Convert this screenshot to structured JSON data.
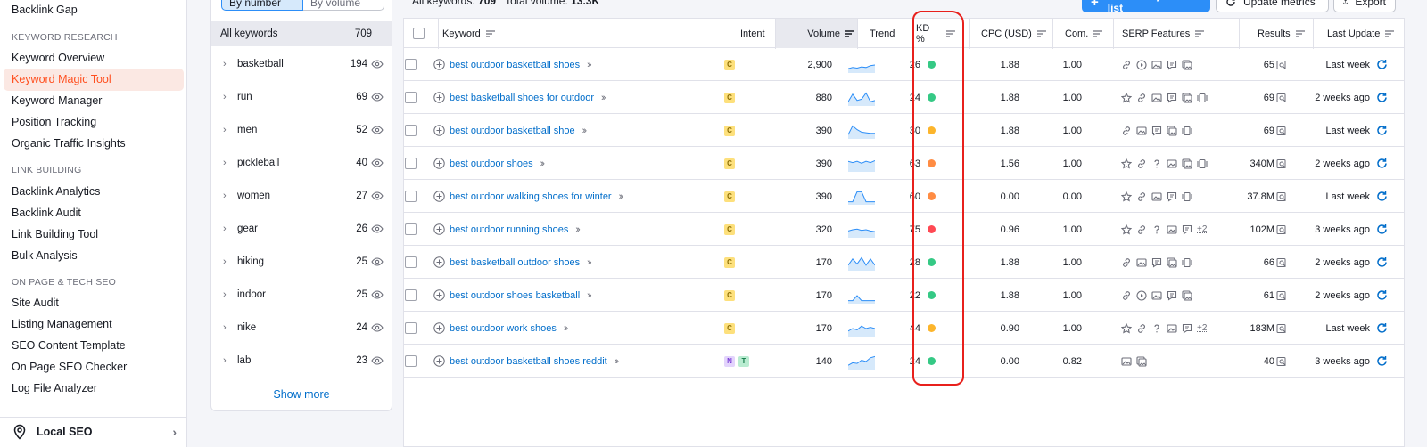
{
  "nav": {
    "top_item": "Backlink Gap",
    "sections": [
      {
        "title": "KEYWORD RESEARCH",
        "items": [
          "Keyword Overview",
          "Keyword Magic Tool",
          "Keyword Manager",
          "Position Tracking",
          "Organic Traffic Insights"
        ]
      },
      {
        "title": "LINK BUILDING",
        "items": [
          "Backlink Analytics",
          "Backlink Audit",
          "Link Building Tool",
          "Bulk Analysis"
        ]
      },
      {
        "title": "ON PAGE & TECH SEO",
        "items": [
          "Site Audit",
          "Listing Management",
          "SEO Content Template",
          "On Page SEO Checker",
          "Log File Analyzer"
        ]
      }
    ],
    "active_item": "Keyword Magic Tool",
    "footer": "Local SEO",
    "accent": "#ff4f1f"
  },
  "groups": {
    "tabs": [
      "By number",
      "By volume"
    ],
    "selected_tab": "By number",
    "all_label": "All keywords",
    "all_count": "709",
    "items": [
      {
        "name": "basketball",
        "count": "194"
      },
      {
        "name": "run",
        "count": "69"
      },
      {
        "name": "men",
        "count": "52"
      },
      {
        "name": "pickleball",
        "count": "40"
      },
      {
        "name": "women",
        "count": "27"
      },
      {
        "name": "gear",
        "count": "26"
      },
      {
        "name": "hiking",
        "count": "25"
      },
      {
        "name": "indoor",
        "count": "25"
      },
      {
        "name": "nike",
        "count": "24"
      },
      {
        "name": "lab",
        "count": "23"
      }
    ],
    "show_more": "Show more"
  },
  "summary": {
    "all_keywords_label": "All keywords:",
    "all_keywords_value": "709",
    "total_volume_label": "Total volume:",
    "total_volume_value": "13.3K"
  },
  "toolbar": {
    "add_label": "Add to keyword list",
    "update_label": "Update metrics",
    "export_label": "Export"
  },
  "table": {
    "columns": [
      "Keyword",
      "Intent",
      "Volume",
      "Trend",
      "KD %",
      "CPC (USD)",
      "Com.",
      "SERP Features",
      "Results",
      "Last Update"
    ],
    "rows": [
      {
        "keyword": "best outdoor basketball shoes",
        "intent": [
          "C"
        ],
        "volume": "2,900",
        "kd": "26",
        "kd_color": "#35c985",
        "cpc": "1.88",
        "com": "1.00",
        "serp": [
          "link",
          "video",
          "image",
          "review",
          "gallery"
        ],
        "serp_extra": "",
        "results": "65",
        "updated": "Last week",
        "trend": [
          0.2,
          0.3,
          0.25,
          0.35,
          0.3,
          0.45,
          0.5
        ]
      },
      {
        "keyword": "best basketball shoes for outdoor",
        "intent": [
          "C"
        ],
        "volume": "880",
        "kd": "24",
        "kd_color": "#35c985",
        "cpc": "1.88",
        "com": "1.00",
        "serp": [
          "star",
          "link",
          "image",
          "review",
          "gallery",
          "video2"
        ],
        "serp_extra": "",
        "results": "69",
        "updated": "2 weeks ago",
        "trend": [
          0.2,
          0.8,
          0.3,
          0.4,
          0.9,
          0.2,
          0.3
        ]
      },
      {
        "keyword": "best outdoor basketball shoe",
        "intent": [
          "C"
        ],
        "volume": "390",
        "kd": "30",
        "kd_color": "#fcb52c",
        "cpc": "1.88",
        "com": "1.00",
        "serp": [
          "link",
          "image",
          "review",
          "gallery",
          "video2"
        ],
        "serp_extra": "",
        "results": "69",
        "updated": "Last week",
        "trend": [
          0.2,
          0.9,
          0.6,
          0.4,
          0.35,
          0.3,
          0.3
        ]
      },
      {
        "keyword": "best outdoor shoes",
        "intent": [
          "C"
        ],
        "volume": "390",
        "kd": "63",
        "kd_color": "#ff8c43",
        "cpc": "1.56",
        "com": "1.00",
        "serp": [
          "star",
          "link",
          "question",
          "image",
          "gallery",
          "video2"
        ],
        "serp_extra": "",
        "results": "340M",
        "updated": "2 weeks ago",
        "trend": [
          0.7,
          0.6,
          0.7,
          0.55,
          0.7,
          0.6,
          0.75
        ]
      },
      {
        "keyword": "best outdoor walking shoes for winter",
        "intent": [
          "C"
        ],
        "volume": "390",
        "kd": "60",
        "kd_color": "#ff8c43",
        "cpc": "0.00",
        "com": "0.00",
        "serp": [
          "star",
          "link",
          "image",
          "review",
          "video2"
        ],
        "serp_extra": "",
        "results": "37.8M",
        "updated": "Last week",
        "trend": [
          0.1,
          0.1,
          0.9,
          0.9,
          0.1,
          0.1,
          0.1
        ]
      },
      {
        "keyword": "best outdoor running shoes",
        "intent": [
          "C"
        ],
        "volume": "320",
        "kd": "75",
        "kd_color": "#ff4953",
        "cpc": "0.96",
        "com": "1.00",
        "serp": [
          "star",
          "link",
          "question",
          "image",
          "review"
        ],
        "serp_extra": "+2",
        "results": "102M",
        "updated": "3 weeks ago",
        "trend": [
          0.4,
          0.5,
          0.55,
          0.45,
          0.5,
          0.4,
          0.35
        ]
      },
      {
        "keyword": "best basketball outdoor shoes",
        "intent": [
          "C"
        ],
        "volume": "170",
        "kd": "28",
        "kd_color": "#35c985",
        "cpc": "1.88",
        "com": "1.00",
        "serp": [
          "link",
          "image",
          "review",
          "gallery",
          "video2"
        ],
        "serp_extra": "",
        "results": "66",
        "updated": "2 weeks ago",
        "trend": [
          0.3,
          0.8,
          0.4,
          0.9,
          0.3,
          0.8,
          0.3
        ]
      },
      {
        "keyword": "best outdoor shoes basketball",
        "intent": [
          "C"
        ],
        "volume": "170",
        "kd": "22",
        "kd_color": "#35c985",
        "cpc": "1.88",
        "com": "1.00",
        "serp": [
          "link",
          "video",
          "image",
          "review",
          "gallery"
        ],
        "serp_extra": "",
        "results": "61",
        "updated": "2 weeks ago",
        "trend": [
          0.1,
          0.1,
          0.5,
          0.1,
          0.1,
          0.1,
          0.1
        ]
      },
      {
        "keyword": "best outdoor work shoes",
        "intent": [
          "C"
        ],
        "volume": "170",
        "kd": "44",
        "kd_color": "#fcb52c",
        "cpc": "0.90",
        "com": "1.00",
        "serp": [
          "star",
          "link",
          "question",
          "image",
          "review"
        ],
        "serp_extra": "+2",
        "results": "183M",
        "updated": "Last week",
        "trend": [
          0.3,
          0.5,
          0.4,
          0.7,
          0.5,
          0.6,
          0.5
        ]
      },
      {
        "keyword": "best outdoor basketball shoes reddit",
        "intent": [
          "N",
          "T"
        ],
        "volume": "140",
        "kd": "24",
        "kd_color": "#35c985",
        "cpc": "0.00",
        "com": "0.82",
        "serp": [
          "image",
          "gallery"
        ],
        "serp_extra": "",
        "results": "40",
        "updated": "3 weeks ago",
        "trend": [
          0.2,
          0.4,
          0.35,
          0.6,
          0.5,
          0.8,
          0.9
        ]
      }
    ]
  }
}
